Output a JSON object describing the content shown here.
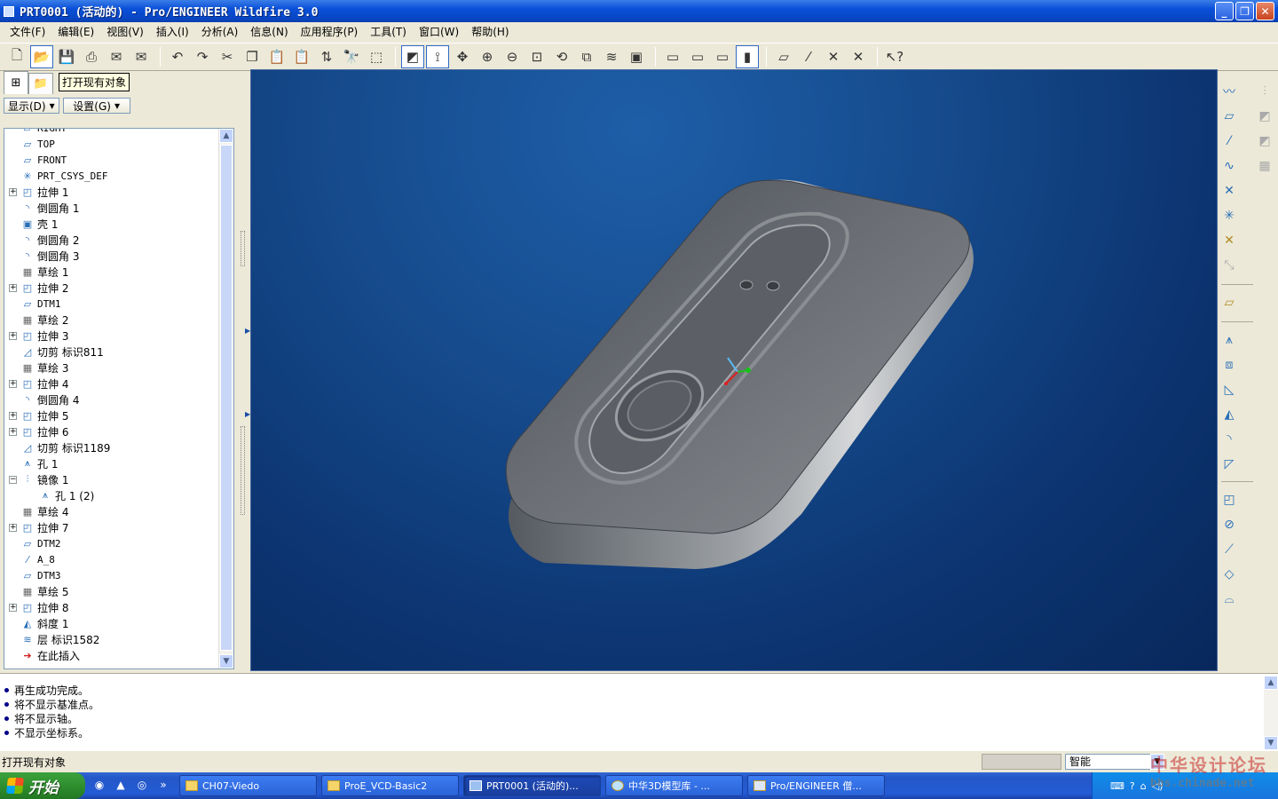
{
  "window": {
    "title": "PRT0001 (活动的) - Pro/ENGINEER Wildfire 3.0",
    "min_label": "_",
    "max_label": "❐",
    "close_label": "✕"
  },
  "menu": [
    "文件(F)",
    "编辑(E)",
    "视图(V)",
    "插入(I)",
    "分析(A)",
    "信息(N)",
    "应用程序(P)",
    "工具(T)",
    "窗口(W)",
    "帮助(H)"
  ],
  "tooltip": "打开现有对象",
  "tree_buttons": {
    "show": "显示(D)",
    "settings": "设置(G)"
  },
  "tree": [
    {
      "label": "RIGHT",
      "icon": "datum-plane-icon",
      "expandable": false
    },
    {
      "label": "TOP",
      "icon": "datum-plane-icon",
      "expandable": false
    },
    {
      "label": "FRONT",
      "icon": "datum-plane-icon",
      "expandable": false
    },
    {
      "label": "PRT_CSYS_DEF",
      "icon": "csys-icon",
      "expandable": false
    },
    {
      "label": "拉伸 1",
      "icon": "extrude-icon",
      "expandable": true
    },
    {
      "label": "倒圆角 1",
      "icon": "round-icon",
      "expandable": false
    },
    {
      "label": "壳 1",
      "icon": "shell-icon",
      "expandable": false
    },
    {
      "label": "倒圆角 2",
      "icon": "round-icon",
      "expandable": false
    },
    {
      "label": "倒圆角 3",
      "icon": "round-icon",
      "expandable": false
    },
    {
      "label": "草绘 1",
      "icon": "sketch-icon",
      "expandable": false
    },
    {
      "label": "拉伸 2",
      "icon": "extrude-icon",
      "expandable": true
    },
    {
      "label": "DTM1",
      "icon": "datum-plane-icon",
      "expandable": false
    },
    {
      "label": "草绘 2",
      "icon": "sketch-icon",
      "expandable": false
    },
    {
      "label": "拉伸 3",
      "icon": "extrude-icon",
      "expandable": true
    },
    {
      "label": "切剪 标识811",
      "icon": "cut-icon",
      "expandable": false
    },
    {
      "label": "草绘 3",
      "icon": "sketch-icon",
      "expandable": false
    },
    {
      "label": "拉伸 4",
      "icon": "extrude-icon",
      "expandable": true
    },
    {
      "label": "倒圆角 4",
      "icon": "round-icon",
      "expandable": false
    },
    {
      "label": "拉伸 5",
      "icon": "extrude-icon",
      "expandable": true
    },
    {
      "label": "拉伸 6",
      "icon": "extrude-icon",
      "expandable": true
    },
    {
      "label": "切剪 标识1189",
      "icon": "cut-icon",
      "expandable": false
    },
    {
      "label": "孔 1",
      "icon": "hole-icon",
      "expandable": false
    },
    {
      "label": "镜像 1",
      "icon": "mirror-icon",
      "expandable": true,
      "expanded": true
    },
    {
      "label": "孔 1 (2)",
      "icon": "hole-icon",
      "expandable": false,
      "child": true
    },
    {
      "label": "草绘 4",
      "icon": "sketch-icon",
      "expandable": false
    },
    {
      "label": "拉伸 7",
      "icon": "extrude-icon",
      "expandable": true
    },
    {
      "label": "DTM2",
      "icon": "datum-plane-icon",
      "expandable": false
    },
    {
      "label": "A_8",
      "icon": "axis-icon",
      "expandable": false
    },
    {
      "label": "DTM3",
      "icon": "datum-plane-icon",
      "expandable": false
    },
    {
      "label": "草绘 5",
      "icon": "sketch-icon",
      "expandable": false
    },
    {
      "label": "拉伸 8",
      "icon": "extrude-icon",
      "expandable": true
    },
    {
      "label": "斜度 1",
      "icon": "draft-icon",
      "expandable": false
    },
    {
      "label": "层 标识1582",
      "icon": "layer-icon",
      "expandable": false
    },
    {
      "label": "在此插入",
      "icon": "insert-here-icon",
      "expandable": false
    }
  ],
  "messages": [
    "再生成功完成。",
    "将不显示基准点。",
    "将不显示轴。",
    "不显示坐标系。"
  ],
  "status": {
    "text": "打开现有对象",
    "filter": "智能"
  },
  "taskbar": {
    "start": "开始",
    "tasks": [
      "CH07-Viedo",
      "ProE_VCD-Basic2",
      "PRT0001 (活动的)...",
      "中华3D模型库 - ...",
      "Pro/ENGINEER 僧..."
    ]
  },
  "watermark": {
    "text": "中华设计论坛",
    "url": "bbs.chinade.net"
  }
}
